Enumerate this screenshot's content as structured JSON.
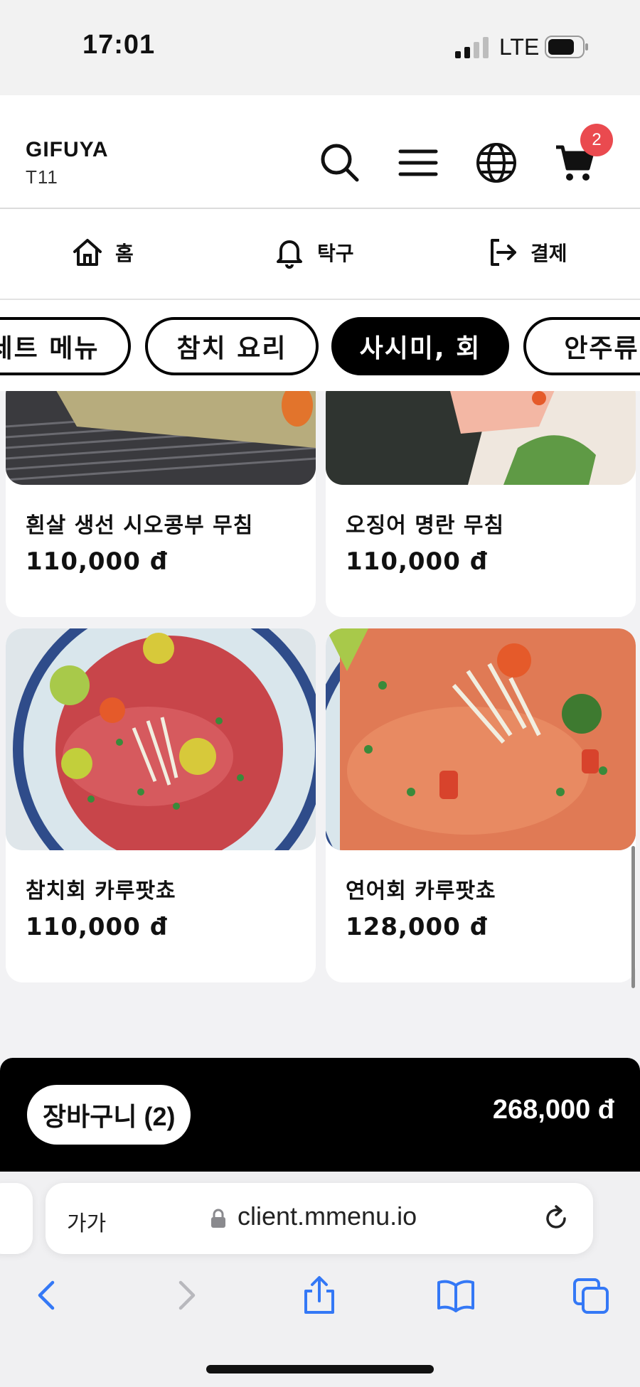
{
  "status": {
    "time": "17:01",
    "network": "LTE"
  },
  "header": {
    "brand": "GIFUYA",
    "table": "T11",
    "cart_count": "2"
  },
  "nav": [
    {
      "label": "홈",
      "icon": "home-icon"
    },
    {
      "label": "탁구",
      "icon": "bell-icon"
    },
    {
      "label": "결제",
      "icon": "sign-out-icon"
    }
  ],
  "categories": [
    {
      "label": "세트 메뉴",
      "active": false
    },
    {
      "label": "참치 요리",
      "active": false
    },
    {
      "label": "사시미, 회",
      "active": true
    },
    {
      "label": "안주류",
      "active": false
    }
  ],
  "items": [
    {
      "name": "흰살 생선 시오콩부 무침",
      "price": "110,000 đ"
    },
    {
      "name": "오징어 명란 무침",
      "price": "110,000 đ"
    },
    {
      "name": "참치회 카루팟쵸",
      "price": "110,000 đ"
    },
    {
      "name": "연어회 카루팟쵸",
      "price": "128,000 đ"
    }
  ],
  "cart": {
    "label": "장바구니 (2)",
    "total": "268,000 đ"
  },
  "browser": {
    "text_size_label": "가가",
    "url": "client.mmenu.io"
  },
  "colors": {
    "accent": "#000000",
    "badge": "#ea4a4f",
    "browser_blue": "#3478f6"
  }
}
